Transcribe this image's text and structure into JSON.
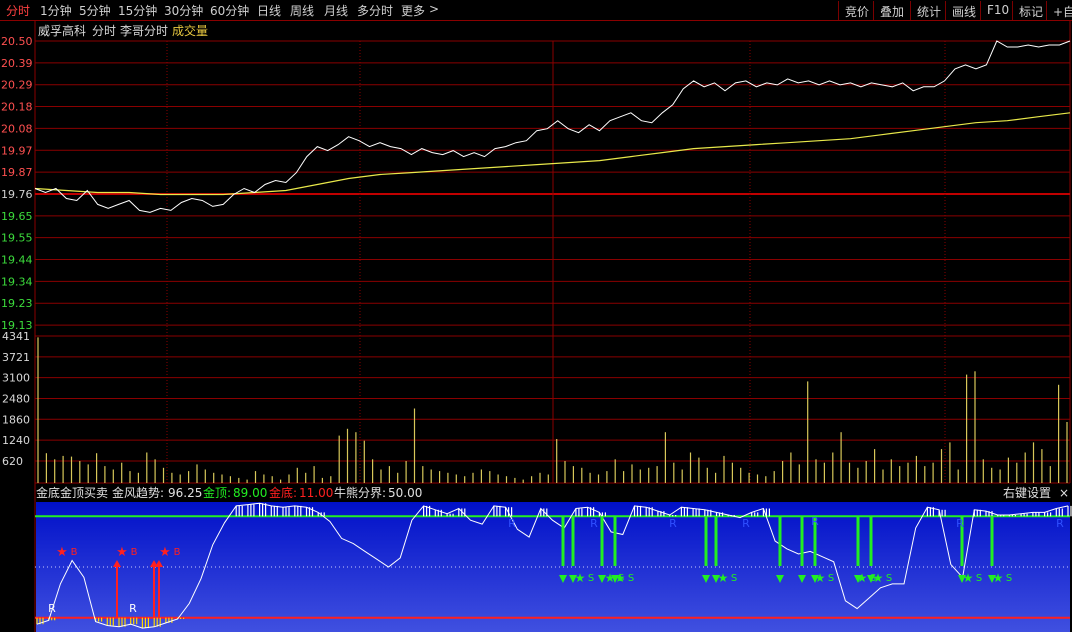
{
  "toolbar": {
    "timeframes": [
      {
        "label": "分时",
        "active": true
      },
      {
        "label": "1分钟"
      },
      {
        "label": "5分钟"
      },
      {
        "label": "15分钟"
      },
      {
        "label": "30分钟"
      },
      {
        "label": "60分钟"
      },
      {
        "label": "日线"
      },
      {
        "label": "周线"
      },
      {
        "label": "月线"
      },
      {
        "label": "多分时"
      },
      {
        "label": "更多"
      }
    ],
    "more_chevron": ">",
    "right_buttons": [
      "竞价",
      "叠加",
      "统计",
      "画线",
      "F10",
      "标记",
      "+自"
    ]
  },
  "price_panel": {
    "stock_name": "威孚高科",
    "mode_label": "分时",
    "indicator_label": "李哥分时",
    "volume_label": "成交量",
    "y_labels": [
      "20.50",
      "20.39",
      "20.29",
      "20.18",
      "20.08",
      "19.97",
      "19.87",
      "19.76",
      "19.65",
      "19.55",
      "19.44",
      "19.34",
      "19.23",
      "19.13"
    ],
    "reference_price": "19.76"
  },
  "volume_panel": {
    "y_labels": [
      "4341",
      "3721",
      "3100",
      "2480",
      "1860",
      "1240",
      "620"
    ]
  },
  "indicator_panel": {
    "title": "金底金顶买卖",
    "trend_label": "金风趋势:",
    "trend_value": "96.25",
    "top_label": "金顶:",
    "top_value": "89.00",
    "bottom_label": "金底:",
    "bottom_value": "11.00",
    "divide_label": "牛熊分界:",
    "divide_value": "50.00",
    "settings_button": "右键设置",
    "close_glyph": "×",
    "buy_marker": "B",
    "sell_marker": "S",
    "r_marker": "R"
  },
  "colors": {
    "grid": "#8a0000",
    "price_line": "#ffffff",
    "avg_line": "#e8e84a",
    "up_text": "#ff5050",
    "down_text": "#3cdc3c",
    "top_line": "#22ee22",
    "bottom_line": "#ff2020",
    "volume_bar": "#d8c85a"
  },
  "chart_data": [
    {
      "type": "line",
      "series": [
        {
          "values": [
            19.76,
            19.74,
            19.76,
            19.71,
            19.7,
            19.75,
            19.68,
            19.66,
            19.68,
            19.7,
            19.65,
            19.64,
            19.66,
            19.65,
            19.69,
            19.71,
            19.7,
            19.67,
            19.68,
            19.73,
            19.76,
            19.74,
            19.78,
            19.8,
            19.79,
            19.84,
            19.92,
            19.97,
            19.95,
            19.98,
            20.02,
            20.0,
            19.97,
            19.99,
            19.97,
            19.96,
            19.93,
            19.96,
            19.94,
            19.93,
            19.95,
            19.92,
            19.94,
            19.92,
            19.96,
            19.97,
            19.99,
            20.0,
            20.05,
            20.06,
            20.1,
            20.06,
            20.04,
            20.08,
            20.05,
            20.1,
            20.12,
            20.14,
            20.1,
            20.09,
            20.14,
            20.18,
            20.26,
            20.3,
            20.27,
            20.29,
            20.25,
            20.29,
            20.3,
            20.27,
            20.29,
            20.28,
            20.31,
            20.29,
            20.3,
            20.28,
            20.3,
            20.28,
            20.29,
            20.27,
            20.29,
            20.28,
            20.27,
            20.29,
            20.25,
            20.27,
            20.27,
            20.3,
            20.36,
            20.38,
            20.36,
            20.38,
            20.5,
            20.47,
            20.47,
            20.48,
            20.47,
            20.48,
            20.48,
            20.5
          ]
        },
        {
          "values": [
            19.76,
            19.75,
            19.74,
            19.74,
            19.73,
            19.73,
            19.73,
            19.74,
            19.75,
            19.78,
            19.81,
            19.83,
            19.84,
            19.85,
            19.86,
            19.87,
            19.88,
            19.89,
            19.9,
            19.92,
            19.94,
            19.96,
            19.97,
            19.98,
            19.99,
            20.0,
            20.01,
            20.03,
            20.05,
            20.07,
            20.09,
            20.1,
            20.12,
            20.14
          ]
        }
      ],
      "ylim": [
        19.02,
        20.5
      ]
    },
    {
      "type": "bar",
      "values": [
        4300,
        880,
        700,
        800,
        780,
        650,
        550,
        880,
        500,
        400,
        600,
        350,
        300,
        900,
        700,
        450,
        300,
        250,
        350,
        550,
        400,
        300,
        250,
        200,
        150,
        100,
        350,
        250,
        200,
        100,
        250,
        450,
        300,
        500,
        150,
        200,
        1400,
        1600,
        1500,
        1250,
        700,
        400,
        500,
        300,
        650,
        2200,
        500,
        400,
        350,
        300,
        250,
        200,
        300,
        400,
        350,
        250,
        200,
        150,
        100,
        200,
        300,
        250,
        1300,
        650,
        500,
        450,
        300,
        250,
        350,
        700,
        350,
        550,
        400,
        450,
        500,
        1500,
        600,
        400,
        900,
        750,
        450,
        300,
        800,
        600,
        450,
        300,
        250,
        200,
        350,
        650,
        900,
        550,
        3000,
        700,
        600,
        900,
        1500,
        600,
        450,
        650,
        1000,
        400,
        700,
        500,
        600,
        800,
        500,
        600,
        1000,
        1200,
        400,
        3200,
        3300,
        700,
        450,
        400,
        750,
        600,
        900,
        1200,
        1000,
        500,
        2900,
        1800
      ],
      "ylim": [
        0,
        4341
      ]
    },
    {
      "type": "line",
      "series": [
        {
          "values": [
            6,
            9,
            37,
            55,
            42,
            8,
            5,
            4,
            6,
            3,
            4,
            7,
            10,
            22,
            41,
            67,
            84,
            97,
            98,
            99,
            97,
            96,
            97,
            96,
            92,
            85,
            72,
            68,
            62,
            56,
            50,
            57,
            86,
            97,
            94,
            91,
            95,
            86,
            83,
            97,
            96,
            79,
            73,
            95,
            86,
            80,
            95,
            96,
            92,
            77,
            75,
            97,
            96,
            93,
            90,
            96,
            95,
            94,
            92,
            90,
            88,
            92,
            95,
            70,
            64,
            60,
            62,
            58,
            54,
            24,
            18,
            26,
            34,
            37,
            37,
            80,
            96,
            94,
            52,
            42,
            94,
            93,
            90,
            90,
            91,
            92,
            92,
            95,
            97
          ]
        }
      ],
      "ylim": [
        0,
        100
      ]
    }
  ]
}
